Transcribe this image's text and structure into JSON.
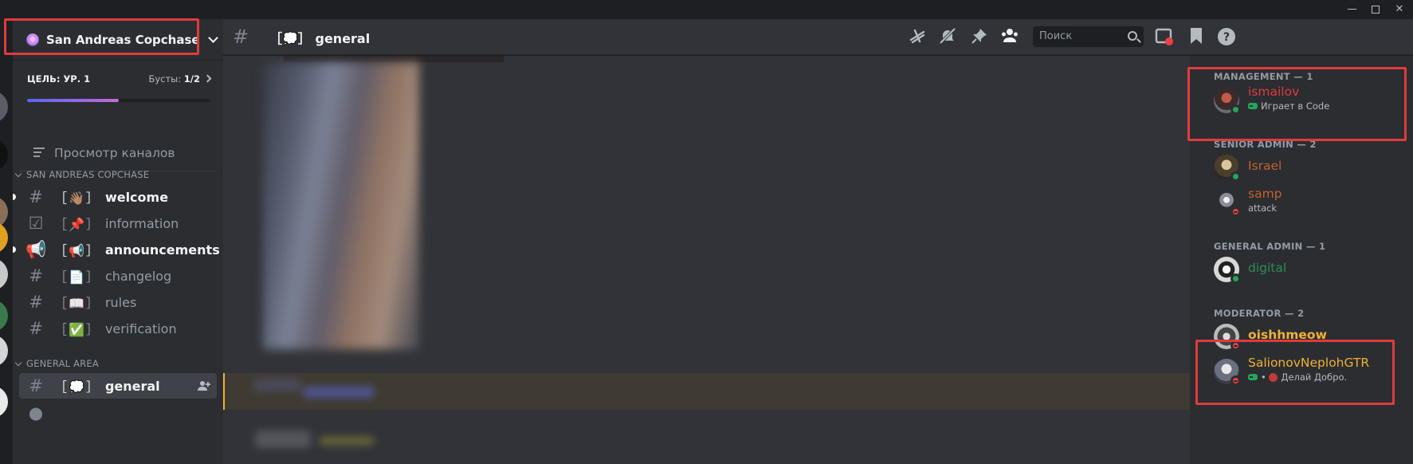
{
  "window": {
    "controls": [
      "minimize",
      "maximize",
      "close"
    ]
  },
  "server": {
    "name": "San Andreas Copchase",
    "boost": {
      "goal_label": "ЦЕЛЬ: УР. 1",
      "boosts_label": "Бусты:",
      "boosts_value": "1/2",
      "progress_fraction": 0.5
    },
    "browse_label": "Просмотр каналов",
    "categories": [
      {
        "name": "SAN ANDREAS COPCHASE",
        "channels": [
          {
            "emoji": "［👋🏽］",
            "name": "welcome",
            "type": "text",
            "unread": true
          },
          {
            "emoji": "［📌］",
            "name": "information",
            "type": "rules",
            "unread": false
          },
          {
            "emoji": "［📢］",
            "name": "announcements",
            "type": "announcement",
            "unread": true
          },
          {
            "emoji": "［📄］",
            "name": "changelog",
            "type": "text",
            "unread": false
          },
          {
            "emoji": "［📖］",
            "name": "rules",
            "type": "text",
            "unread": false
          },
          {
            "emoji": "［✅］",
            "name": "verification",
            "type": "text",
            "unread": false
          }
        ]
      },
      {
        "name": "GENERAL AREA",
        "channels": [
          {
            "emoji": "［💭］",
            "name": "general",
            "type": "text",
            "active": true
          }
        ]
      }
    ]
  },
  "header": {
    "channel_title": "［💭］ general",
    "search_placeholder": "Поиск",
    "icons": [
      "threads-icon",
      "mute-icon",
      "pin-icon",
      "members-icon",
      "inbox-icon",
      "bookmark-icon",
      "help-icon"
    ]
  },
  "members": {
    "groups": [
      {
        "role": "MANAGEMENT — 1",
        "members": [
          {
            "name": "ismailov",
            "color": "#e03b3b",
            "status": "online",
            "activity": "Играет в Code"
          }
        ]
      },
      {
        "role": "SENIOR ADMIN — 2",
        "members": [
          {
            "name": "Israel",
            "color": "#c0632a",
            "status": "online"
          },
          {
            "name": "samp",
            "color": "#c0632a",
            "status": "dnd",
            "activity": "attack"
          }
        ]
      },
      {
        "role": "GENERAL ADMIN — 1",
        "members": [
          {
            "name": "digital",
            "color": "#2e8b57",
            "status": "online"
          }
        ]
      },
      {
        "role": "MODERATOR — 2",
        "members": [
          {
            "name": "oishhmeow",
            "color": "#f0b232",
            "status": "dnd"
          },
          {
            "name": "SalionovNeplohGTR",
            "color": "#f0b232",
            "status": "dnd",
            "activity": "Делай Добро."
          }
        ]
      }
    ]
  },
  "colors": {
    "accent": "#5865f2",
    "highlight_box": "#e03b3b",
    "mention": "#f0b232"
  }
}
